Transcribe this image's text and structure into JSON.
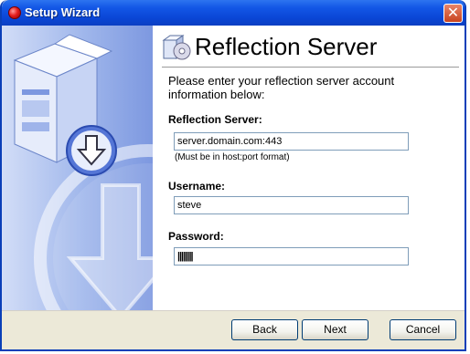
{
  "window": {
    "title": "Setup Wizard"
  },
  "header": {
    "title": "Reflection Server",
    "icon": "server-install-icon"
  },
  "intro_text": "Please enter your reflection server account information below:",
  "form": {
    "server": {
      "label": "Reflection Server:",
      "value": "server.domain.com:443",
      "hint": "(Must be in host:port format)"
    },
    "username": {
      "label": "Username:",
      "value": "steve"
    },
    "password": {
      "label": "Password:",
      "value": "||||||||"
    }
  },
  "buttons": {
    "back": "Back",
    "next": "Next",
    "cancel": "Cancel"
  },
  "colors": {
    "titlebar": "#0a46d6",
    "panel_gradient_start": "#d2ddf7",
    "panel_gradient_end": "#7d98e0"
  }
}
